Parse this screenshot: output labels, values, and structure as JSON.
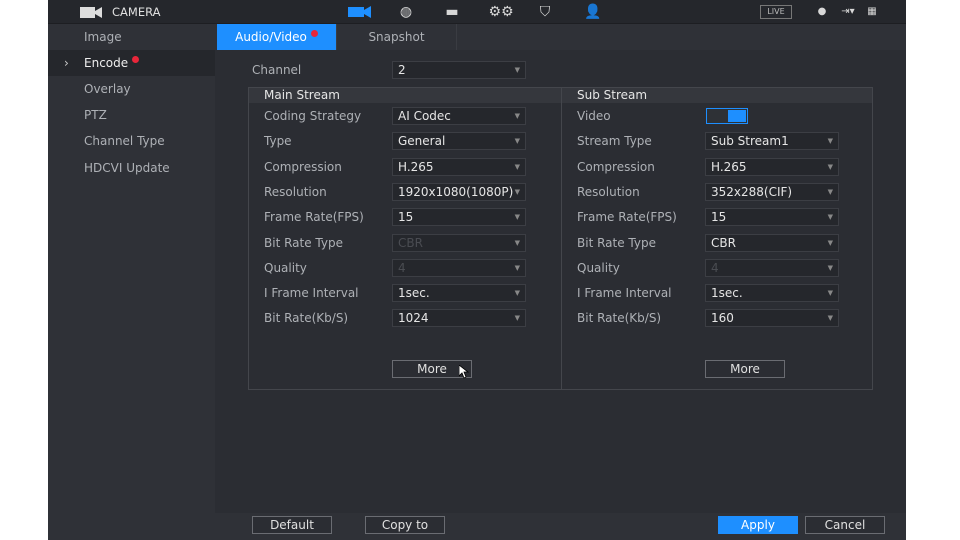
{
  "header": {
    "title": "CAMERA",
    "live": "LIVE",
    "nav_icons": [
      "camera-icon",
      "network-icon",
      "storage-icon",
      "system-settings-icon",
      "security-shield-icon",
      "account-icon"
    ],
    "right_icons": [
      "user-icon",
      "logout-icon",
      "qr-code-icon"
    ]
  },
  "sidebar": {
    "items": [
      {
        "label": "Image"
      },
      {
        "label": "Encode",
        "active": true,
        "badge": true
      },
      {
        "label": "Overlay"
      },
      {
        "label": "PTZ"
      },
      {
        "label": "Channel Type"
      },
      {
        "label": "HDCVI Update"
      }
    ]
  },
  "tabs": [
    {
      "label": "Audio/Video",
      "active": true,
      "badge": true
    },
    {
      "label": "Snapshot"
    }
  ],
  "channel": {
    "label": "Channel",
    "value": "2"
  },
  "main_stream": {
    "title": "Main Stream",
    "rows": [
      {
        "label": "Coding Strategy",
        "value": "AI Codec"
      },
      {
        "label": "Type",
        "value": "General"
      },
      {
        "label": "Compression",
        "value": "H.265"
      },
      {
        "label": "Resolution",
        "value": "1920x1080(1080P)"
      },
      {
        "label": "Frame Rate(FPS)",
        "value": "15"
      },
      {
        "label": "Bit Rate Type",
        "value": "CBR",
        "disabled": true
      },
      {
        "label": "Quality",
        "value": "4",
        "disabled": true
      },
      {
        "label": "I Frame Interval",
        "value": "1sec."
      },
      {
        "label": "Bit Rate(Kb/S)",
        "value": "1024"
      }
    ],
    "more": "More"
  },
  "sub_stream": {
    "title": "Sub Stream",
    "video_label": "Video",
    "video_enabled": true,
    "rows": [
      {
        "label": "Stream Type",
        "value": "Sub Stream1"
      },
      {
        "label": "Compression",
        "value": "H.265"
      },
      {
        "label": "Resolution",
        "value": "352x288(CIF)"
      },
      {
        "label": "Frame Rate(FPS)",
        "value": "15"
      },
      {
        "label": "Bit Rate Type",
        "value": "CBR"
      },
      {
        "label": "Quality",
        "value": "4",
        "disabled": true
      },
      {
        "label": "I Frame Interval",
        "value": "1sec."
      },
      {
        "label": "Bit Rate(Kb/S)",
        "value": "160"
      }
    ],
    "more": "More"
  },
  "footer": {
    "default": "Default",
    "copy_to": "Copy to",
    "apply": "Apply",
    "cancel": "Cancel"
  },
  "colors": {
    "accent": "#1e8fff",
    "badge": "#e8263a"
  }
}
